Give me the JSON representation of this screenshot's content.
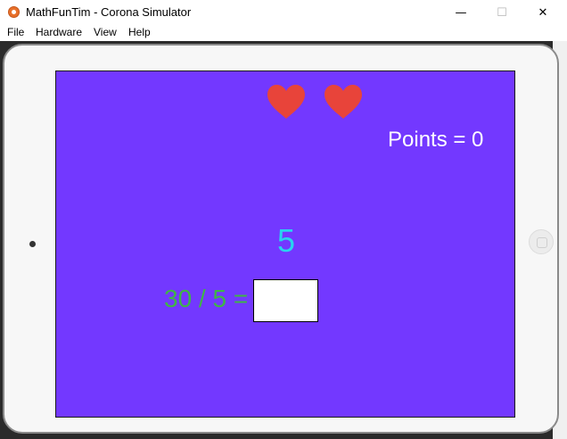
{
  "window": {
    "title": "MathFunTim - Corona Simulator",
    "minimize_glyph": "—",
    "maximize_glyph": "☐",
    "close_glyph": "✕"
  },
  "menu": {
    "items": [
      "File",
      "Hardware",
      "View",
      "Help"
    ]
  },
  "game": {
    "lives": 2,
    "heart_color": "#e8443a",
    "background_color": "#7338ff",
    "points_text": "Points = 0",
    "answer_display": "5",
    "question_text": "30 / 5 =",
    "answer_input_value": ""
  }
}
